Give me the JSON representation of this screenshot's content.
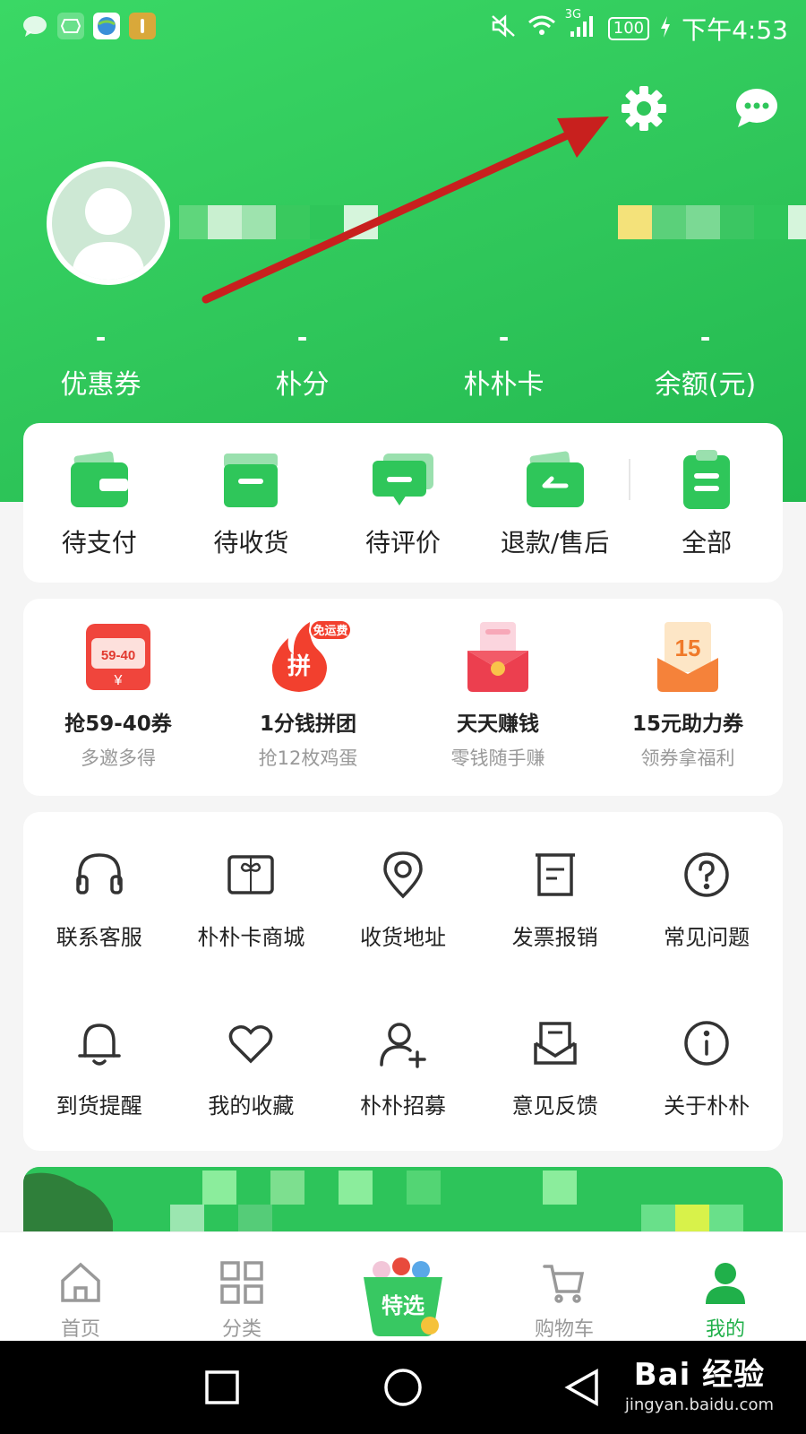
{
  "status_bar": {
    "time": "下午4:53",
    "battery": "100",
    "network": "3G"
  },
  "stats": [
    {
      "value": "-",
      "label": "优惠券"
    },
    {
      "value": "-",
      "label": "朴分"
    },
    {
      "value": "-",
      "label": "朴朴卡"
    },
    {
      "value": "-",
      "label": "余额(元)"
    }
  ],
  "orders": [
    {
      "label": "待支付",
      "icon": "wallet-icon"
    },
    {
      "label": "待收货",
      "icon": "box-icon"
    },
    {
      "label": "待评价",
      "icon": "comment-icon"
    },
    {
      "label": "退款/售后",
      "icon": "refund-icon"
    },
    {
      "label": "全部",
      "icon": "clipboard-icon"
    }
  ],
  "promos": [
    {
      "title": "抢59-40券",
      "subtitle": "多邀多得",
      "badge": "59-40",
      "icon": "coupon-red-icon"
    },
    {
      "title": "1分钱拼团",
      "subtitle": "抢12枚鸡蛋",
      "badge": "免运费",
      "badge2": "拼",
      "icon": "fire-icon"
    },
    {
      "title": "天天赚钱",
      "subtitle": "零钱随手赚",
      "icon": "red-packet-icon"
    },
    {
      "title": "15元助力券",
      "subtitle": "领券拿福利",
      "badge": "15",
      "icon": "coupon-orange-icon"
    }
  ],
  "services_row1": [
    {
      "label": "联系客服",
      "icon": "headset-icon"
    },
    {
      "label": "朴朴卡商城",
      "icon": "gift-card-icon"
    },
    {
      "label": "收货地址",
      "icon": "location-icon"
    },
    {
      "label": "发票报销",
      "icon": "invoice-icon"
    },
    {
      "label": "常见问题",
      "icon": "question-icon"
    }
  ],
  "services_row2": [
    {
      "label": "到货提醒",
      "icon": "bell-icon"
    },
    {
      "label": "我的收藏",
      "icon": "heart-icon"
    },
    {
      "label": "朴朴招募",
      "icon": "add-user-icon"
    },
    {
      "label": "意见反馈",
      "icon": "feedback-icon"
    },
    {
      "label": "关于朴朴",
      "icon": "info-icon"
    }
  ],
  "tabs": [
    {
      "label": "首页",
      "icon": "home-icon"
    },
    {
      "label": "分类",
      "icon": "grid-icon"
    },
    {
      "label": "",
      "badge": "特选",
      "icon": "basket-icon"
    },
    {
      "label": "购物车",
      "icon": "cart-icon"
    },
    {
      "label": "我的",
      "icon": "user-icon"
    }
  ],
  "watermark": {
    "brand": "Bai 经验",
    "url": "jingyan.baidu.com"
  },
  "colors": {
    "brand_green": "#2fc65a",
    "active_tab": "#20b04a",
    "arrow_red": "#c8201e"
  }
}
